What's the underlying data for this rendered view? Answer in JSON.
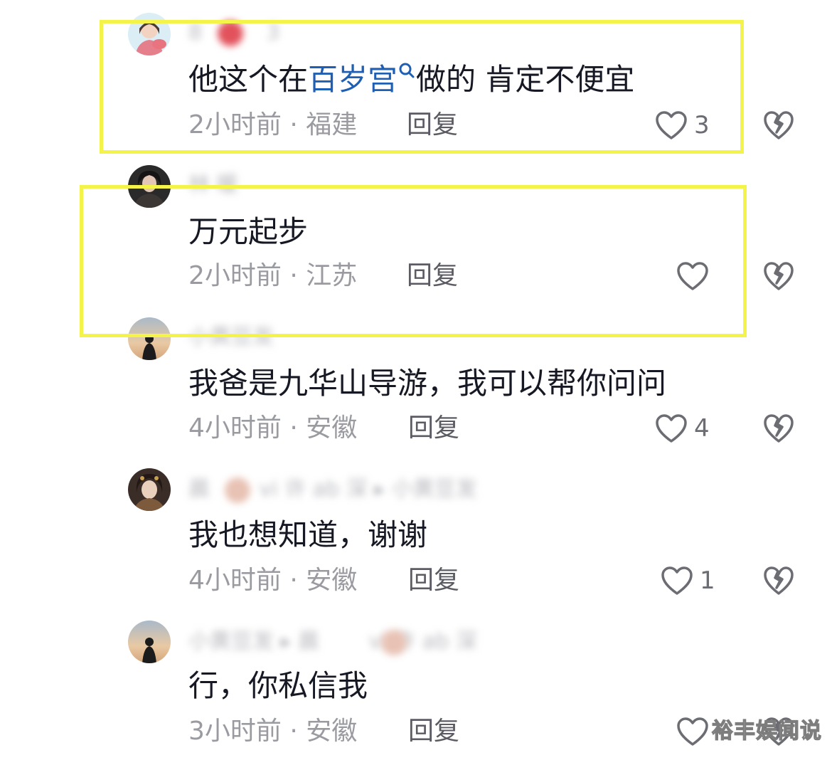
{
  "comments": [
    {
      "username": "8   3",
      "content_prefix": "他这个在",
      "content_link": "百岁宫",
      "content_suffix": "做的 肯定不便宜",
      "time": "2小时前",
      "location": "福建",
      "meta_sep": " · ",
      "reply_label": "回复",
      "likes": "3"
    },
    {
      "username": "林 暖",
      "content": "万元起步",
      "time": "2小时前",
      "location": "江苏",
      "meta_sep": " · ",
      "reply_label": "回复",
      "likes": ""
    },
    {
      "username": "小黄豆发",
      "content": "我爸是九华山导游，我可以帮你问问",
      "time": "4小时前",
      "location": "安徽",
      "meta_sep": " · ",
      "reply_label": "回复",
      "likes": "4"
    },
    {
      "username": "晨   vi 许 ab 深 ▸ 小黄豆发",
      "content": "我也想知道，谢谢",
      "time": "4小时前",
      "location": "安徽",
      "meta_sep": " · ",
      "reply_label": "回复",
      "likes": "1"
    },
    {
      "username": "小黄豆发 ▸ 晨   vi 许 ab 深",
      "content": "行，你私信我",
      "time": "3小时前",
      "location": "安徽",
      "meta_sep": " · ",
      "reply_label": "回复",
      "likes": ""
    }
  ],
  "watermark": "裕丰娱闻说",
  "colors": {
    "highlight": "#f3f34a",
    "link": "#1f5fb3",
    "meta": "#9a9ba1",
    "icon": "#6c6d73"
  },
  "icons": {
    "like": "heart-outline-icon",
    "dislike": "broken-heart-icon",
    "search": "search-icon"
  }
}
